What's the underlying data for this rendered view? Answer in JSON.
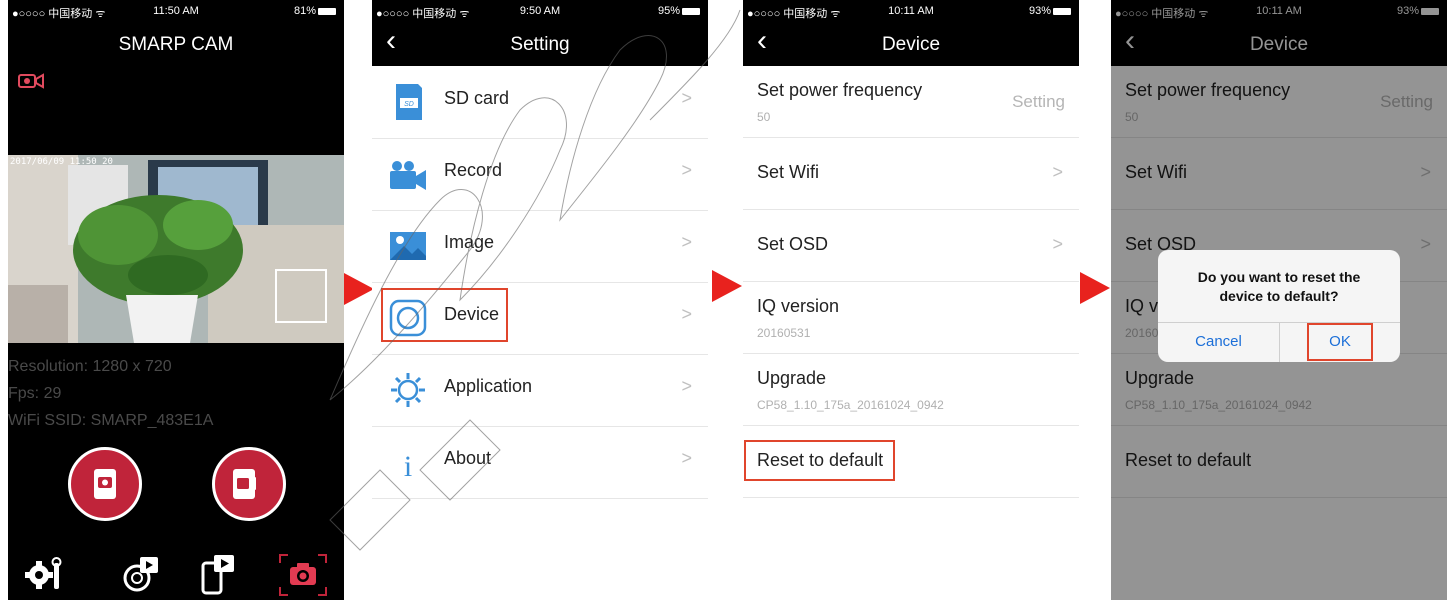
{
  "screens": {
    "home": {
      "status": {
        "carrier": "●○○○○ 中国移动 ᯤ",
        "time": "11:50 AM",
        "battery": "81%"
      },
      "app_name": "SMARP CAM",
      "timestamp": "2017/06/09 11:50 20",
      "resolution": "Resolution: 1280 x 720",
      "fps": "Fps: 29",
      "ssid": "WiFi SSID: SMARP_483E1A"
    },
    "setting": {
      "status": {
        "carrier": "●○○○○ 中国移动 ᯤ",
        "time": "9:50 AM",
        "battery": "95%"
      },
      "title": "Setting",
      "items": [
        {
          "label": "SD card"
        },
        {
          "label": "Record"
        },
        {
          "label": "Image"
        },
        {
          "label": "Device"
        },
        {
          "label": "Application"
        },
        {
          "label": "About"
        }
      ]
    },
    "device": {
      "status": {
        "carrier": "●○○○○ 中国移动 ᯤ",
        "time": "10:11 AM",
        "battery": "93%"
      },
      "title": "Device",
      "items": [
        {
          "label": "Set power frequency",
          "sub": "50",
          "action": "Setting"
        },
        {
          "label": "Set Wifi"
        },
        {
          "label": "Set OSD"
        },
        {
          "label": "IQ version",
          "sub": "20160531"
        },
        {
          "label": "Upgrade",
          "sub": "CP58_1.10_175a_20161024_0942"
        },
        {
          "label": "Reset to default"
        }
      ]
    },
    "dialog": {
      "status": {
        "carrier": "●○○○○ 中国移动 ᯤ",
        "time": "10:11 AM",
        "battery": "93%"
      },
      "title": "Device",
      "message_line1": "Do you want to reset the",
      "message_line2": "device to default?",
      "cancel_label": "Cancel",
      "ok_label": "OK"
    }
  },
  "chevron": ">",
  "colors": {
    "accent_red": "#e8221e",
    "highlight_box": "#e0452c",
    "brand_red": "#c0243a",
    "ios_blue": "#1c6fd8"
  },
  "icons": [
    "camera-record-icon",
    "sd-card-icon",
    "record-icon",
    "image-icon",
    "device-icon",
    "application-gear-icon",
    "about-info-icon",
    "snapshot-button-icon",
    "video-record-button-icon",
    "settings-tools-icon",
    "playback-icon",
    "phone-gallery-icon",
    "camera-tab-icon"
  ]
}
